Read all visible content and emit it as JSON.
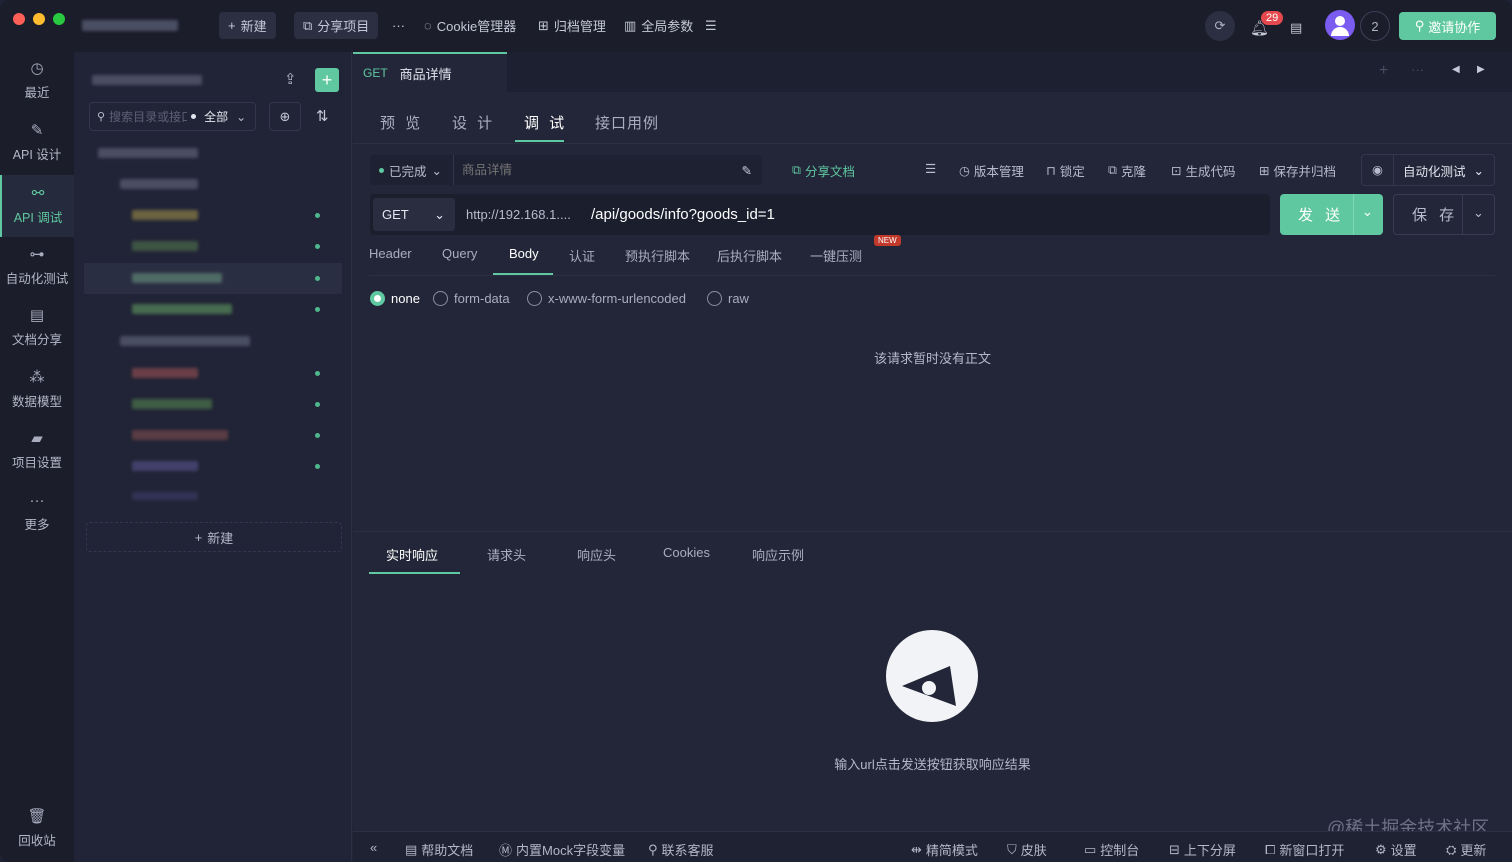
{
  "titlebar": {
    "new_label": "新建",
    "share_project_label": "分享项目",
    "more_label": "···",
    "cookie_label": "Cookie管理器",
    "archive_label": "归档管理",
    "global_params_label": "全局参数",
    "notification_count": "29",
    "member_count": "2",
    "invite_label": "邀请协作"
  },
  "nav": {
    "items": [
      {
        "label": "最近",
        "icon": "clock-icon"
      },
      {
        "label": "API 设计",
        "icon": "edit-icon"
      },
      {
        "label": "API 调试",
        "icon": "link-icon"
      },
      {
        "label": "自动化测试",
        "icon": "flow-icon"
      },
      {
        "label": "文档分享",
        "icon": "doc-share-icon"
      },
      {
        "label": "数据模型",
        "icon": "model-icon"
      },
      {
        "label": "项目设置",
        "icon": "folder-settings-icon"
      },
      {
        "label": "更多",
        "icon": "more-icon"
      }
    ],
    "recycle_label": "回收站"
  },
  "tree": {
    "search_placeholder": "搜索目录或接口",
    "filter_label": "全部",
    "new_label": "新建"
  },
  "doc_tab": {
    "method": "GET",
    "title": "商品详情"
  },
  "subtabs": [
    "预 览",
    "设 计",
    "调 试",
    "接口用例"
  ],
  "status": {
    "value": "已完成",
    "name_placeholder": "商品详情"
  },
  "tools": {
    "share_doc": "分享文档",
    "version": "版本管理",
    "lock": "锁定",
    "clone": "克隆",
    "gen_code": "生成代码",
    "save_archive": "保存并归档",
    "auto_test": "自动化测试"
  },
  "request": {
    "method": "GET",
    "base_url": "http://192.168.1....",
    "path": "/api/goods/info?goods_id=1",
    "send_label": "发 送",
    "save_label": "保 存"
  },
  "req_tabs": [
    "Header",
    "Query",
    "Body",
    "认证",
    "预执行脚本",
    "后执行脚本",
    "一键压测"
  ],
  "new_badge": "NEW",
  "body_types": [
    "none",
    "form-data",
    "x-www-form-urlencoded",
    "raw"
  ],
  "body_empty": "该请求暂时没有正文",
  "resp_tabs": [
    "实时响应",
    "请求头",
    "响应头",
    "Cookies",
    "响应示例"
  ],
  "resp_empty": "输入url点击发送按钮获取响应结果",
  "statusbar": {
    "help": "帮助文档",
    "mock": "内置Mock字段变量",
    "support": "联系客服",
    "simple": "精简模式",
    "skin": "皮肤",
    "console": "控制台",
    "split": "上下分屏",
    "new_window": "新窗口打开",
    "settings": "设置",
    "update": "更新"
  },
  "watermark": "@稀土掘金技术社区",
  "colors": {
    "accent": "#5fc8a0",
    "bg": "#232638",
    "badge": "#e5484d"
  }
}
